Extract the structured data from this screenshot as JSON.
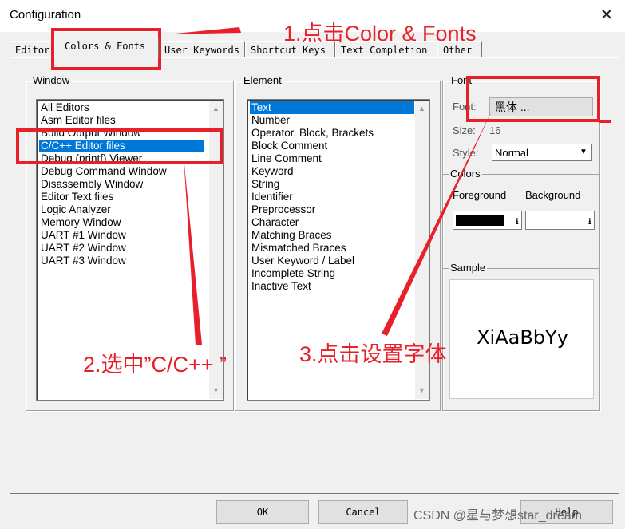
{
  "window": {
    "title": "Configuration",
    "close_glyph": "✕"
  },
  "tabs": [
    {
      "label": "Editor"
    },
    {
      "label": "Colors & Fonts"
    },
    {
      "label": "User Keywords"
    },
    {
      "label": "Shortcut Keys"
    },
    {
      "label": "Text Completion"
    },
    {
      "label": "Other"
    }
  ],
  "window_group": {
    "label": "Window",
    "items": [
      "All Editors",
      "Asm Editor files",
      "Build Output Window",
      "C/C++ Editor files",
      "Debug (printf) Viewer",
      "Debug Command Window",
      "Disassembly Window",
      "Editor Text files",
      "Logic Analyzer",
      "Memory Window",
      "UART #1 Window",
      "UART #2 Window",
      "UART #3 Window"
    ],
    "selected": "C/C++ Editor files"
  },
  "element_group": {
    "label": "Element",
    "items": [
      "Text",
      "Number",
      "Operator, Block, Brackets",
      "Block Comment",
      "Line Comment",
      "Keyword",
      "String",
      "Identifier",
      "Preprocessor",
      "Character",
      "Matching Braces",
      "Mismatched Braces",
      "User Keyword / Label",
      "Incomplete String",
      "Inactive Text"
    ],
    "selected": "Text"
  },
  "font_group": {
    "label": "Font",
    "font_label": "Font:",
    "font_value": "黑体 ...",
    "size_label": "Size:",
    "size_value": "16",
    "style_label": "Style:",
    "style_value": "Normal"
  },
  "colors_group": {
    "label": "Colors",
    "foreground_label": "Foreground",
    "background_label": "Background",
    "foreground_color": "#000000",
    "background_color": "#ffffff"
  },
  "sample_group": {
    "label": "Sample",
    "sample_text": "XiAaBbYy"
  },
  "buttons": {
    "ok": "OK",
    "cancel": "Cancel",
    "help": "Help"
  },
  "annotations": {
    "step1": "1.点击Color & Fonts",
    "step2": "2.选中”C/C++ ”",
    "step3": "3.点击设置字体",
    "color": "#e8202a"
  },
  "watermark": "CSDN @星与梦想star_dream"
}
